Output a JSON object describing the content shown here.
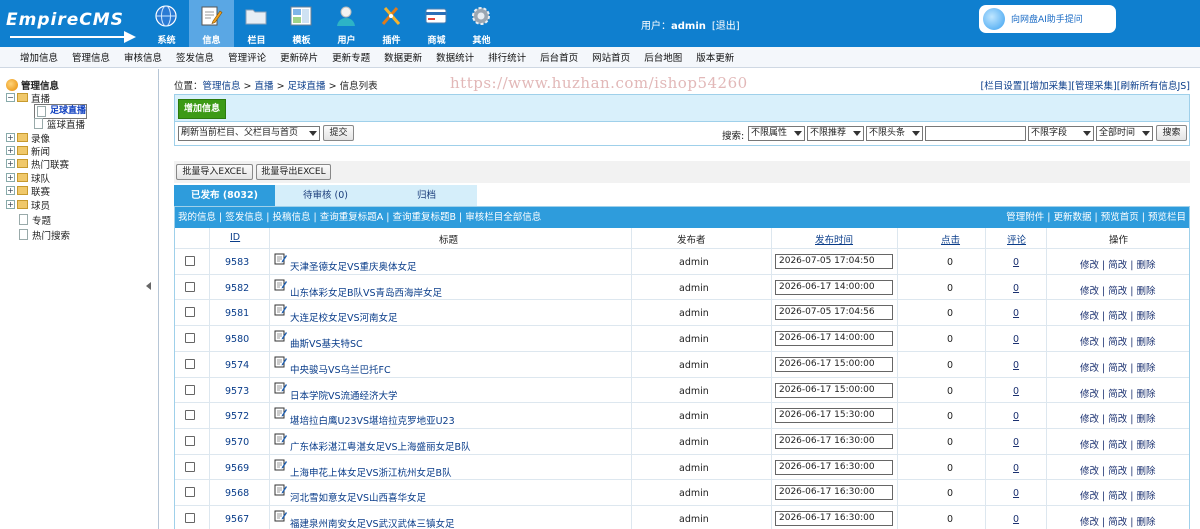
{
  "header": {
    "logo_text": "EmpireCMS",
    "nav": [
      {
        "label": "系统",
        "icon": "globe-icon",
        "active": false
      },
      {
        "label": "信息",
        "icon": "edit-icon",
        "active": true
      },
      {
        "label": "栏目",
        "icon": "folder-icon",
        "active": false
      },
      {
        "label": "模板",
        "icon": "template-icon",
        "active": false
      },
      {
        "label": "用户",
        "icon": "user-icon",
        "active": false
      },
      {
        "label": "插件",
        "icon": "tools-icon",
        "active": false
      },
      {
        "label": "商城",
        "icon": "card-icon",
        "active": false
      },
      {
        "label": "其他",
        "icon": "gear-icon",
        "active": false
      }
    ],
    "user_label": "用户：",
    "user_name": "admin",
    "logout": "[退出]",
    "ai_button": "向网盘AI助手提问"
  },
  "menubar": [
    "增加信息",
    "管理信息",
    "审核信息",
    "签发信息",
    "管理评论",
    "更新碎片",
    "更新专题",
    "数据更新",
    "数据统计",
    "排行统计",
    "后台首页",
    "网站首页",
    "后台地图",
    "版本更新"
  ],
  "tree": {
    "root": "管理信息",
    "items": [
      {
        "label": "直播",
        "type": "folder-open"
      },
      {
        "label": "足球直播",
        "type": "doc",
        "selected": true
      },
      {
        "label": "篮球直播",
        "type": "doc"
      },
      {
        "label": "录像",
        "type": "folder"
      },
      {
        "label": "新闻",
        "type": "folder"
      },
      {
        "label": "热门联赛",
        "type": "folder"
      },
      {
        "label": "球队",
        "type": "folder"
      },
      {
        "label": "联赛",
        "type": "folder"
      },
      {
        "label": "球员",
        "type": "folder"
      },
      {
        "label": "专题",
        "type": "doc"
      },
      {
        "label": "热门搜索",
        "type": "doc"
      }
    ]
  },
  "breadcrumb": {
    "prefix": "位置：",
    "items": [
      "管理信息",
      "直播",
      "足球直播"
    ],
    "current": "信息列表",
    "sep": " > ",
    "right_links": [
      "[栏目设置]",
      "[增加采集]",
      "[管理采集]",
      "[刷新所有信息JS]"
    ]
  },
  "watermark": "https://www.huzhan.com/ishop54260",
  "add_button": "增加信息",
  "toolbar": {
    "refresh_select": "刷新当前栏目、父栏目与首页",
    "submit": "提交",
    "search_label": "搜索:",
    "filters": [
      "不限属性",
      "不限推荐",
      "不限头条"
    ],
    "field_select": "不限字段",
    "time_select": "全部时间",
    "search_button": "搜索"
  },
  "excel": {
    "import": "批量导入EXCEL",
    "export": "批量导出EXCEL"
  },
  "tabs": [
    "已发布 (8032)",
    "待审核 (0)",
    "归档"
  ],
  "subbar": {
    "left": "我的信息 | 签发信息 | 投稿信息 | 查询重复标题A | 查询重复标题B | 审核栏目全部信息",
    "right": "管理附件 | 更新数据 | 预览首页 | 预览栏目"
  },
  "columns": {
    "id": "ID",
    "title": "标题",
    "publisher": "发布者",
    "time": "发布时间",
    "clicks": "点击",
    "comments": "评论",
    "actions": "操作"
  },
  "row_actions": "修改 | 简改 | 删除",
  "rows": [
    {
      "id": "9583",
      "title": "天津圣德女足VS重庆奥体女足",
      "publisher": "admin",
      "time": "2026-07-05 17:04:50",
      "clicks": "0",
      "comments": "0"
    },
    {
      "id": "9582",
      "title": "山东体彩女足B队VS青岛西海岸女足",
      "publisher": "admin",
      "time": "2026-06-17 14:00:00",
      "clicks": "0",
      "comments": "0"
    },
    {
      "id": "9581",
      "title": "大连足校女足VS河南女足",
      "publisher": "admin",
      "time": "2026-07-05 17:04:56",
      "clicks": "0",
      "comments": "0"
    },
    {
      "id": "9580",
      "title": "曲斯VS基夫特SC",
      "publisher": "admin",
      "time": "2026-06-17 14:00:00",
      "clicks": "0",
      "comments": "0"
    },
    {
      "id": "9574",
      "title": "中央骏马VS乌兰巴托FC",
      "publisher": "admin",
      "time": "2026-06-17 15:00:00",
      "clicks": "0",
      "comments": "0"
    },
    {
      "id": "9573",
      "title": "日本学院VS流通经济大学",
      "publisher": "admin",
      "time": "2026-06-17 15:00:00",
      "clicks": "0",
      "comments": "0"
    },
    {
      "id": "9572",
      "title": "堪培拉白鹰U23VS堪培拉克罗地亚U23",
      "publisher": "admin",
      "time": "2026-06-17 15:30:00",
      "clicks": "0",
      "comments": "0"
    },
    {
      "id": "9570",
      "title": "广东体彩湛江粤湛女足VS上海盛丽女足B队",
      "publisher": "admin",
      "time": "2026-06-17 16:30:00",
      "clicks": "0",
      "comments": "0"
    },
    {
      "id": "9569",
      "title": "上海申花上体女足VS浙江杭州女足B队",
      "publisher": "admin",
      "time": "2026-06-17 16:30:00",
      "clicks": "0",
      "comments": "0"
    },
    {
      "id": "9568",
      "title": "河北雪如意女足VS山西喜华女足",
      "publisher": "admin",
      "time": "2026-06-17 16:30:00",
      "clicks": "0",
      "comments": "0"
    },
    {
      "id": "9567",
      "title": "福建泉州南安女足VS武汉武体三镇女足",
      "publisher": "admin",
      "time": "2026-06-17 16:30:00",
      "clicks": "0",
      "comments": "0"
    }
  ]
}
